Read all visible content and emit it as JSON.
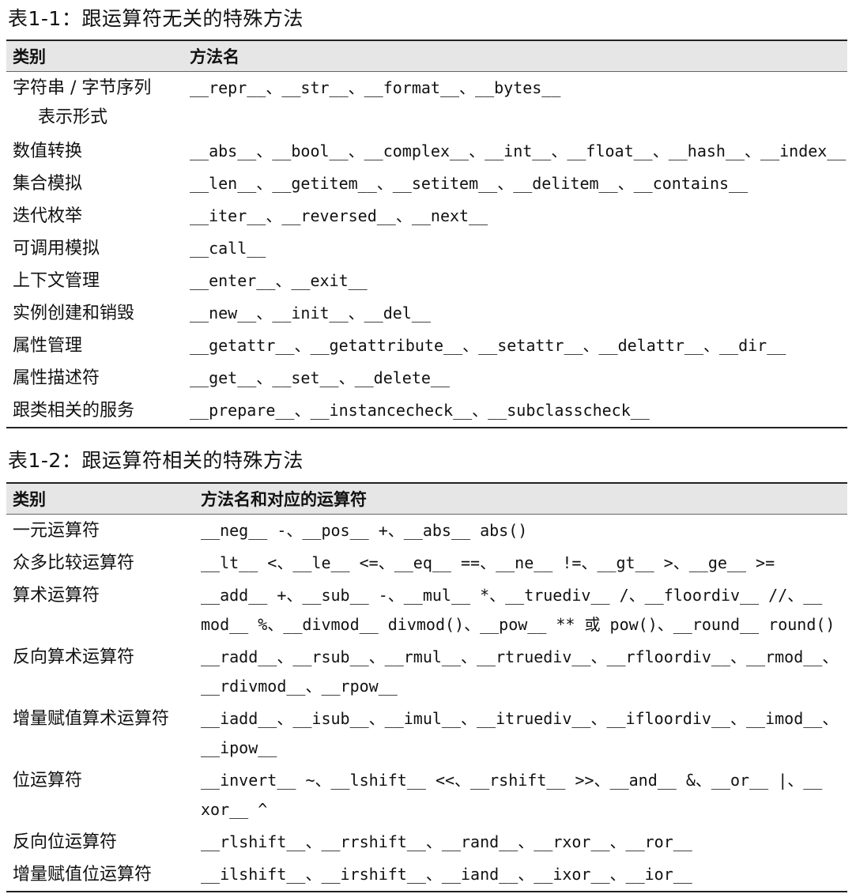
{
  "table1": {
    "caption": "表1-1：跟运算符无关的特殊方法",
    "header": {
      "category": "类别",
      "methods": "方法名"
    },
    "rows": [
      {
        "category": "字符串 / 字节序列",
        "category_line2": "表示形式",
        "methods": "__repr__、__str__、__format__、__bytes__"
      },
      {
        "category": "数值转换",
        "methods": "__abs__、__bool__、__complex__、__int__、__float__、__hash__、__index__"
      },
      {
        "category": "集合模拟",
        "methods": "__len__、__getitem__、__setitem__、__delitem__、__contains__"
      },
      {
        "category": "迭代枚举",
        "methods": "__iter__、__reversed__、__next__"
      },
      {
        "category": "可调用模拟",
        "methods": "__call__"
      },
      {
        "category": "上下文管理",
        "methods": "__enter__、__exit__"
      },
      {
        "category": "实例创建和销毁",
        "methods": "__new__、__init__、__del__"
      },
      {
        "category": "属性管理",
        "methods": "__getattr__、__getattribute__、__setattr__、__delattr__、__dir__"
      },
      {
        "category": "属性描述符",
        "methods": "__get__、__set__、__delete__"
      },
      {
        "category": "跟类相关的服务",
        "methods": "__prepare__、__instancecheck__、__subclasscheck__"
      }
    ]
  },
  "table2": {
    "caption": "表1-2：跟运算符相关的特殊方法",
    "header": {
      "category": "类别",
      "methods": "方法名和对应的运算符"
    },
    "rows": [
      {
        "category": "一元运算符",
        "line1": "__neg__ -、__pos__ +、__abs__ abs()"
      },
      {
        "category": "众多比较运算符",
        "line1": "__lt__ <、__le__ <=、__eq__ ==、__ne__ !=、__gt__ >、__ge__ >="
      },
      {
        "category": "算术运算符",
        "line1": "__add__ +、__sub__ -、__mul__ *、__truediv__ /、__floordiv__ //、__",
        "line2": "mod__ %、__divmod__ divmod()、__pow__ ** 或 pow()、__round__ round()"
      },
      {
        "category": "反向算术运算符",
        "line1": "__radd__、__rsub__、__rmul__、__rtruediv__、__rfloordiv__、__rmod__、",
        "line2": "__rdivmod__、__rpow__"
      },
      {
        "category": "增量赋值算术运算符",
        "line1": "__iadd__、__isub__、__imul__、__itruediv__、__ifloordiv__、__imod__、",
        "line2": "__ipow__"
      },
      {
        "category": "位运算符",
        "line1": "__invert__ ~、__lshift__ <<、__rshift__ >>、__and__ &、__or__ |、__",
        "line2": "xor__ ^"
      },
      {
        "category": "反向位运算符",
        "line1": "__rlshift__、__rrshift__、__rand__、__rxor__、__ror__"
      },
      {
        "category": "增量赋值位运算符",
        "line1": "__ilshift__、__irshift__、__iand__、__ixor__、__ior__"
      }
    ]
  }
}
